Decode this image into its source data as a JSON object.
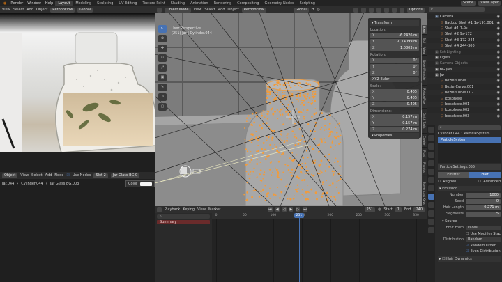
{
  "topbar": {
    "menus": [
      "Render",
      "Window",
      "Help"
    ],
    "workspaces": [
      "Layout",
      "Modeling",
      "Sculpting",
      "UV Editing",
      "Texture Paint",
      "Shading",
      "Animation",
      "Rendering",
      "Compositing",
      "Geometry Nodes",
      "Scripting"
    ],
    "active_workspace": "Layout",
    "scene": "Scene",
    "view_layer": "ViewLayer"
  },
  "left_header": {
    "items": [
      "View",
      "Select",
      "Add",
      "Object"
    ],
    "mode": "RetopoFlow",
    "global": "Global"
  },
  "image_editor": {
    "tools": [
      "Object",
      "View",
      "Select",
      "Add",
      "Node"
    ],
    "use_nodes": "Use Nodes",
    "slot": "Slot 2",
    "material": "Jar Glass BG.0",
    "breadcrumb": [
      "Jar.044",
      "Cylinder.044",
      "Jar Glass BG.003"
    ],
    "color_label": "Color"
  },
  "viewport": {
    "mode": "Object Mode",
    "menus": [
      "View",
      "Select",
      "Add",
      "Object"
    ],
    "retopo": "RetopoFlow",
    "transform": "Global",
    "options": "Options",
    "info_line1": "User Perspective",
    "info_line2": "(251) Jar | Cylinder.044",
    "npanel": {
      "transform": "Transform",
      "location_label": "Location:",
      "location": [
        {
          "axis": "X",
          "value": "-6.2426 m"
        },
        {
          "axis": "Y",
          "value": "-0.14099 m"
        },
        {
          "axis": "Z",
          "value": "1.0803 m"
        }
      ],
      "rotation_label": "Rotation:",
      "rotation": [
        {
          "axis": "X",
          "value": "0°"
        },
        {
          "axis": "Y",
          "value": "0°"
        },
        {
          "axis": "Z",
          "value": "0°"
        }
      ],
      "rotation_mode": "XYZ Euler",
      "scale_label": "Scale:",
      "scale": [
        {
          "axis": "X",
          "value": "0.405"
        },
        {
          "axis": "Y",
          "value": "0.405"
        },
        {
          "axis": "Z",
          "value": "0.405"
        }
      ],
      "dimensions_label": "Dimensions:",
      "dimensions": [
        {
          "axis": "X",
          "value": "0.157 m"
        },
        {
          "axis": "Y",
          "value": "0.157 m"
        },
        {
          "axis": "Z",
          "value": "0.274 m"
        }
      ],
      "properties": "Properties"
    },
    "side_tabs": [
      "Item",
      "Tool",
      "View",
      "Node Wrangler",
      "RetopoFlow",
      "Quick Tools",
      "Create",
      "Fluid",
      "Physics",
      "Screencast Keys",
      "Flip Fluids",
      "Edit"
    ]
  },
  "timeline": {
    "menus": [
      "Playback",
      "Keying",
      "View",
      "Marker"
    ],
    "current_frame": "251",
    "start_label": "Start",
    "start": "1",
    "end_label": "End",
    "end": "240",
    "summary": "Summary",
    "ruler": [
      {
        "label": "0",
        "frac": 0.0
      },
      {
        "label": "50",
        "frac": 0.141
      },
      {
        "label": "100",
        "frac": 0.282
      },
      {
        "label": "150",
        "frac": 0.424
      },
      {
        "label": "200",
        "frac": 0.565
      },
      {
        "label": "250",
        "frac": 0.706
      },
      {
        "label": "300",
        "frac": 0.847
      },
      {
        "label": "350",
        "frac": 0.988
      }
    ],
    "playhead_frac": 0.41
  },
  "outliner": {
    "items": [
      {
        "label": "Camera",
        "depth": 1,
        "color": "#8fa7c8"
      },
      {
        "label": "Backup Shot #1 1s-191.001",
        "depth": 2,
        "color": "#e08a48"
      },
      {
        "label": "Shot #1 1-9s",
        "depth": 2,
        "color": "#e08a48"
      },
      {
        "label": "Shot #2 9s-172",
        "depth": 2,
        "color": "#e08a48"
      },
      {
        "label": "Shot #3 172-244",
        "depth": 2,
        "color": "#e08a48"
      },
      {
        "label": "Shot #4 244-300",
        "depth": 2,
        "color": "#e08a48"
      },
      {
        "label": "Set Lighting",
        "depth": 1,
        "color": "#7e7e7e"
      },
      {
        "label": "Lights",
        "depth": 1,
        "color": "#cfcfcf"
      },
      {
        "label": "Camera Objects",
        "depth": 1,
        "color": "#7e7e7e"
      },
      {
        "label": "BG Jars",
        "depth": 1,
        "color": "#cfcfcf"
      },
      {
        "label": "Jar",
        "depth": 1,
        "color": "#cfcfcf"
      },
      {
        "label": "BezierCurve",
        "depth": 2,
        "color": "#e08a48"
      },
      {
        "label": "BezierCurve.001",
        "depth": 2,
        "color": "#e08a48"
      },
      {
        "label": "BezierCurve.002",
        "depth": 2,
        "color": "#e08a48"
      },
      {
        "label": "Icosphere",
        "depth": 2,
        "color": "#e08a48"
      },
      {
        "label": "Icosphere.001",
        "depth": 2,
        "color": "#e08a48"
      },
      {
        "label": "Icosphere.002",
        "depth": 2,
        "color": "#e08a48"
      },
      {
        "label": "Icosphere.003",
        "depth": 2,
        "color": "#e08a48"
      }
    ]
  },
  "properties": {
    "breadcrumb": [
      "Cylinder.044",
      "ParticleSystem"
    ],
    "system_item": "ParticleSystem",
    "settings": "ParticleSettings.055",
    "emitter": "Emitter",
    "hair": "Hair",
    "regrow": "Regrow",
    "advanced": "Advanced",
    "emission_title": "Emission",
    "fields": [
      {
        "label": "Number",
        "value": "1000"
      },
      {
        "label": "Seed",
        "value": "0"
      },
      {
        "label": "Hair Length",
        "value": "0.271 m"
      },
      {
        "label": "Segments",
        "value": "5"
      }
    ],
    "source_title": "Source",
    "emit_from_label": "Emit From",
    "emit_from": "Faces",
    "use_modifier": "Use Modifier Stack",
    "distribution_label": "Distribution",
    "distribution": "Random",
    "random_order": "Random Order",
    "even_dist": "Even Distribution",
    "hair_dynamics": "Hair Dynamics"
  },
  "colors": {
    "accent": "#4772b3",
    "selection_orange": "#f29b3a",
    "header": "#2e2e2e",
    "panel": "#303030"
  }
}
